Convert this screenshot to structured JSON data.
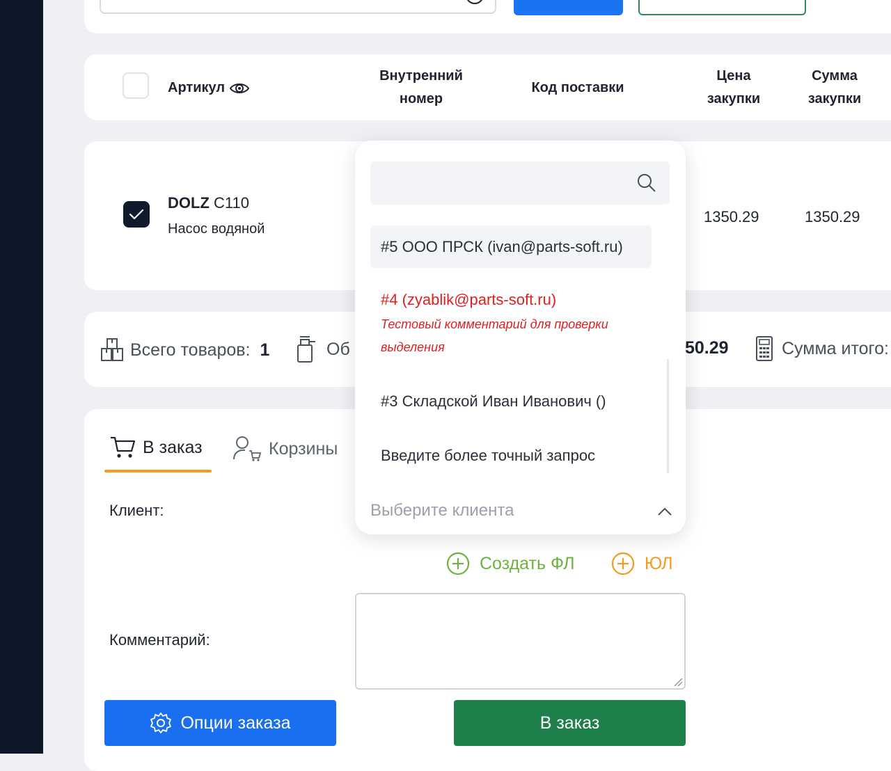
{
  "table": {
    "headers": {
      "article": "Артикул",
      "internal_line1": "Внутренний",
      "internal_line2": "номер",
      "supply_code": "Код поставки",
      "price_line1": "Цена",
      "price_line2": "закупки",
      "sum_line1": "Сумма",
      "sum_line2": "закупки"
    },
    "row": {
      "brand": "DOLZ",
      "code": "C110",
      "name": "Насос водяной",
      "price": "1350.29",
      "sum": "1350.29",
      "checked": true
    }
  },
  "summary": {
    "total_items_label": "Всего товаров:",
    "total_items_value": "1",
    "partial_label": "Об",
    "partial_value": "50.29",
    "total_sum_label": "Сумма итого:"
  },
  "tabs": {
    "order": "В заказ",
    "carts": "Корзины"
  },
  "form": {
    "client_label": "Клиент:",
    "comment_label": "Комментарий:",
    "create_fl": "Создать ФЛ",
    "create_ul": "ЮЛ",
    "comment_value": ""
  },
  "dropdown": {
    "search_value": "",
    "options": [
      {
        "label": "#5 ООО ПРСК (ivan@parts-soft.ru)"
      },
      {
        "label": "#4 (zyablik@parts-soft.ru)",
        "note_line1": "Тестовый комментарий для проверки",
        "note_line2": "выделения"
      },
      {
        "label": "#3 Складской Иван Иванович ()"
      },
      {
        "label": "Введите более точный запрос"
      }
    ],
    "placeholder": "Выберите клиента"
  },
  "buttons": {
    "options": "Опции заказа",
    "order": "В заказ"
  },
  "colors": {
    "sidebar": "#0c1828",
    "primary_blue": "#1a6ff1",
    "order_green": "#1e7f4a",
    "tab_accent": "#f29b1f",
    "create_fl_green": "#6cb33f",
    "create_ul_orange": "#f29b1f",
    "highlight_red": "#e02020"
  }
}
